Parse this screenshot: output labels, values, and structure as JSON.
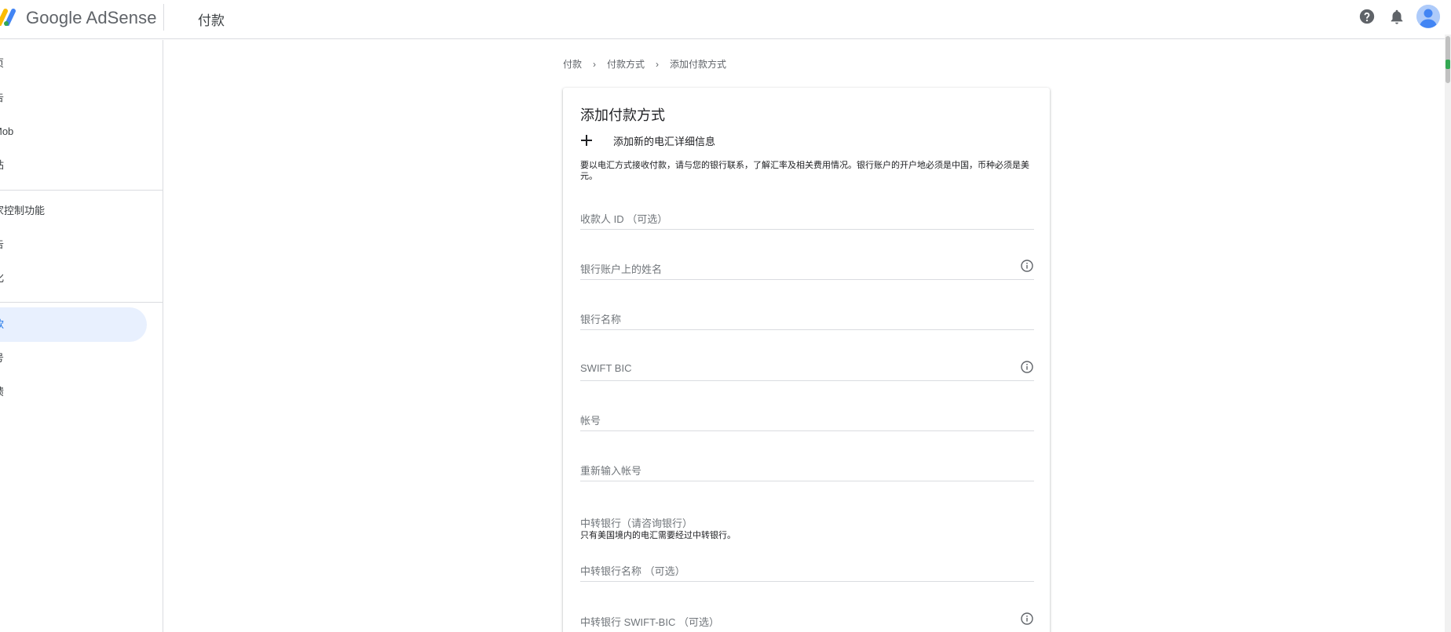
{
  "header": {
    "brand": "Google AdSense",
    "page_title": "付款",
    "icons": [
      "help-icon",
      "notifications-icon",
      "account-avatar"
    ]
  },
  "sidebar": {
    "items": [
      {
        "label": "页"
      },
      {
        "label": "告"
      },
      {
        "label": "Mob"
      },
      {
        "label": "站"
      },
      {
        "label": "家控制功能"
      },
      {
        "label": "告"
      },
      {
        "label": "化"
      },
      {
        "label": "款",
        "active": true
      },
      {
        "label": "号"
      },
      {
        "label": "馈"
      }
    ]
  },
  "breadcrumb": {
    "items": [
      "付款",
      "付款方式",
      "添加付款方式"
    ],
    "separator": "›"
  },
  "card": {
    "title": "添加付款方式",
    "add_label": "添加新的电汇详细信息",
    "description": "要以电汇方式接收付款，请与您的银行联系，了解汇率及相关费用情况。银行账户的开户地必须是中国，币种必须是美元。",
    "fields": {
      "payee_id": "收款人 ID （可选）",
      "account_name": "银行账户上的姓名",
      "bank_name": "银行名称",
      "swift_bic": "SWIFT BIC",
      "account_number": "帐号",
      "account_number_confirm": "重新输入帐号",
      "intermediary_section": "中转银行（请咨询银行）",
      "intermediary_hint": "只有美国境内的电汇需要经过中转银行。",
      "intermediary_name": "中转银行名称 （可选）",
      "intermediary_swift": "中转银行 SWIFT-BIC （可选）"
    }
  },
  "colors": {
    "accent": "#1a73e8",
    "active_bg": "#e8f0fe",
    "divider": "#dadce0",
    "label_gray": "#70757a"
  }
}
